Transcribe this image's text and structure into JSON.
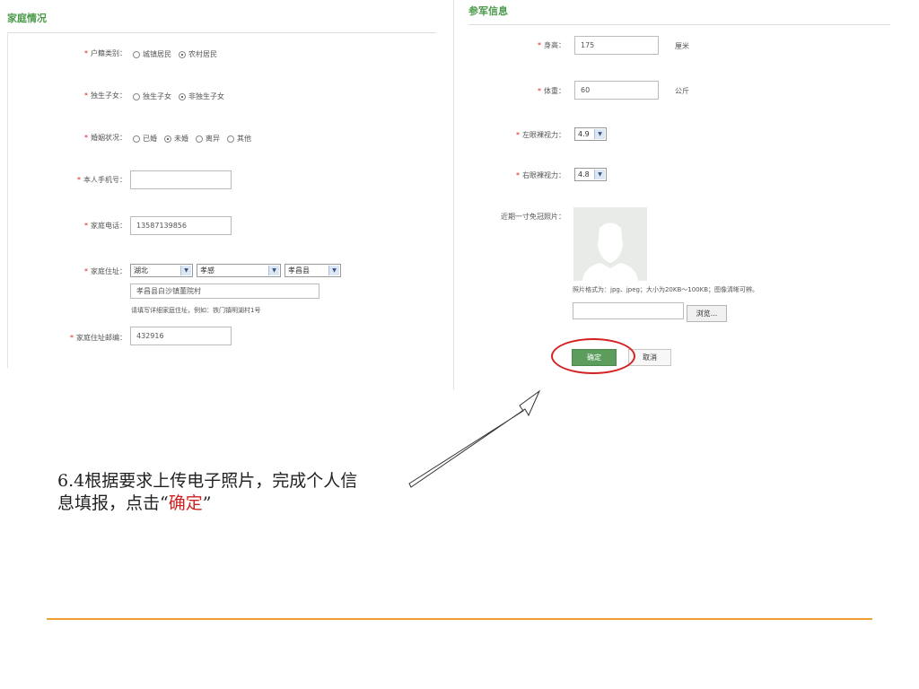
{
  "family": {
    "title": "家庭情况",
    "huji": {
      "label": "户籍类别：",
      "options": [
        "城镇居民",
        "农村居民"
      ],
      "selected": 1
    },
    "dusheng": {
      "label": "独生子女：",
      "options": [
        "独生子女",
        "非独生子女"
      ],
      "selected": 1
    },
    "hunyin": {
      "label": "婚姻状况：",
      "options": [
        "已婚",
        "未婚",
        "离异",
        "其他"
      ],
      "selected": 1
    },
    "mobile": {
      "label": "本人手机号：",
      "value": ""
    },
    "phone": {
      "label": "家庭电话：",
      "value": "13587139856"
    },
    "address": {
      "label": "家庭住址：",
      "province": "湖北",
      "city": "孝感",
      "county": "孝昌县",
      "detail": "孝昌县白沙镇董院村",
      "hint": "请填写详细家庭住址，例如：铁门镇明湖村1号"
    },
    "zipcode": {
      "label": "家庭住址邮编：",
      "value": "432916"
    }
  },
  "military": {
    "title": "参军信息",
    "height": {
      "label": "身高：",
      "value": "175",
      "unit": "厘米"
    },
    "weight": {
      "label": "体重：",
      "value": "60",
      "unit": "公斤"
    },
    "left_eye": {
      "label": "左眼裸视力：",
      "value": "4.9"
    },
    "right_eye": {
      "label": "右眼裸视力：",
      "value": "4.8"
    },
    "photo": {
      "label": "近期一寸免冠照片：",
      "format_hint": "照片格式为：jpg、jpeg；大小为20KB～100KB；图像清晰可辨。",
      "file_value": "",
      "browse_label": "浏览..."
    },
    "confirm_label": "确定",
    "cancel_label": "取消"
  },
  "caption": {
    "text": "6.4根据要求上传电子照片，完成个人信息填报，点击“",
    "highlight": "确定",
    "end": "”"
  },
  "colors": {
    "accent_green": "#4a9a4a",
    "required_red": "#d9251d",
    "rule_orange": "#f0a030",
    "circle_red": "#d42020"
  }
}
